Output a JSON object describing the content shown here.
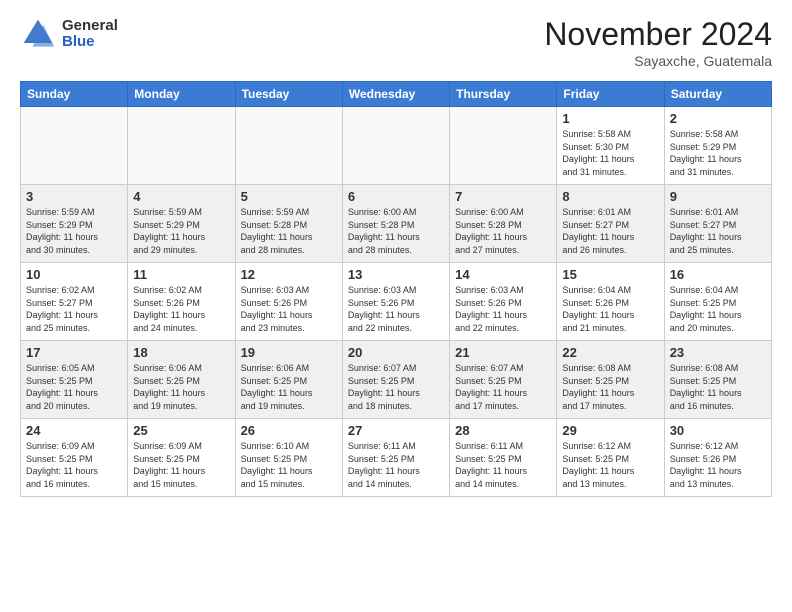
{
  "header": {
    "logo_general": "General",
    "logo_blue": "Blue",
    "month_title": "November 2024",
    "location": "Sayaxche, Guatemala"
  },
  "weekdays": [
    "Sunday",
    "Monday",
    "Tuesday",
    "Wednesday",
    "Thursday",
    "Friday",
    "Saturday"
  ],
  "weeks": [
    [
      {
        "day": "",
        "info": ""
      },
      {
        "day": "",
        "info": ""
      },
      {
        "day": "",
        "info": ""
      },
      {
        "day": "",
        "info": ""
      },
      {
        "day": "",
        "info": ""
      },
      {
        "day": "1",
        "info": "Sunrise: 5:58 AM\nSunset: 5:30 PM\nDaylight: 11 hours\nand 31 minutes."
      },
      {
        "day": "2",
        "info": "Sunrise: 5:58 AM\nSunset: 5:29 PM\nDaylight: 11 hours\nand 31 minutes."
      }
    ],
    [
      {
        "day": "3",
        "info": "Sunrise: 5:59 AM\nSunset: 5:29 PM\nDaylight: 11 hours\nand 30 minutes."
      },
      {
        "day": "4",
        "info": "Sunrise: 5:59 AM\nSunset: 5:29 PM\nDaylight: 11 hours\nand 29 minutes."
      },
      {
        "day": "5",
        "info": "Sunrise: 5:59 AM\nSunset: 5:28 PM\nDaylight: 11 hours\nand 28 minutes."
      },
      {
        "day": "6",
        "info": "Sunrise: 6:00 AM\nSunset: 5:28 PM\nDaylight: 11 hours\nand 28 minutes."
      },
      {
        "day": "7",
        "info": "Sunrise: 6:00 AM\nSunset: 5:28 PM\nDaylight: 11 hours\nand 27 minutes."
      },
      {
        "day": "8",
        "info": "Sunrise: 6:01 AM\nSunset: 5:27 PM\nDaylight: 11 hours\nand 26 minutes."
      },
      {
        "day": "9",
        "info": "Sunrise: 6:01 AM\nSunset: 5:27 PM\nDaylight: 11 hours\nand 25 minutes."
      }
    ],
    [
      {
        "day": "10",
        "info": "Sunrise: 6:02 AM\nSunset: 5:27 PM\nDaylight: 11 hours\nand 25 minutes."
      },
      {
        "day": "11",
        "info": "Sunrise: 6:02 AM\nSunset: 5:26 PM\nDaylight: 11 hours\nand 24 minutes."
      },
      {
        "day": "12",
        "info": "Sunrise: 6:03 AM\nSunset: 5:26 PM\nDaylight: 11 hours\nand 23 minutes."
      },
      {
        "day": "13",
        "info": "Sunrise: 6:03 AM\nSunset: 5:26 PM\nDaylight: 11 hours\nand 22 minutes."
      },
      {
        "day": "14",
        "info": "Sunrise: 6:03 AM\nSunset: 5:26 PM\nDaylight: 11 hours\nand 22 minutes."
      },
      {
        "day": "15",
        "info": "Sunrise: 6:04 AM\nSunset: 5:26 PM\nDaylight: 11 hours\nand 21 minutes."
      },
      {
        "day": "16",
        "info": "Sunrise: 6:04 AM\nSunset: 5:25 PM\nDaylight: 11 hours\nand 20 minutes."
      }
    ],
    [
      {
        "day": "17",
        "info": "Sunrise: 6:05 AM\nSunset: 5:25 PM\nDaylight: 11 hours\nand 20 minutes."
      },
      {
        "day": "18",
        "info": "Sunrise: 6:06 AM\nSunset: 5:25 PM\nDaylight: 11 hours\nand 19 minutes."
      },
      {
        "day": "19",
        "info": "Sunrise: 6:06 AM\nSunset: 5:25 PM\nDaylight: 11 hours\nand 19 minutes."
      },
      {
        "day": "20",
        "info": "Sunrise: 6:07 AM\nSunset: 5:25 PM\nDaylight: 11 hours\nand 18 minutes."
      },
      {
        "day": "21",
        "info": "Sunrise: 6:07 AM\nSunset: 5:25 PM\nDaylight: 11 hours\nand 17 minutes."
      },
      {
        "day": "22",
        "info": "Sunrise: 6:08 AM\nSunset: 5:25 PM\nDaylight: 11 hours\nand 17 minutes."
      },
      {
        "day": "23",
        "info": "Sunrise: 6:08 AM\nSunset: 5:25 PM\nDaylight: 11 hours\nand 16 minutes."
      }
    ],
    [
      {
        "day": "24",
        "info": "Sunrise: 6:09 AM\nSunset: 5:25 PM\nDaylight: 11 hours\nand 16 minutes."
      },
      {
        "day": "25",
        "info": "Sunrise: 6:09 AM\nSunset: 5:25 PM\nDaylight: 11 hours\nand 15 minutes."
      },
      {
        "day": "26",
        "info": "Sunrise: 6:10 AM\nSunset: 5:25 PM\nDaylight: 11 hours\nand 15 minutes."
      },
      {
        "day": "27",
        "info": "Sunrise: 6:11 AM\nSunset: 5:25 PM\nDaylight: 11 hours\nand 14 minutes."
      },
      {
        "day": "28",
        "info": "Sunrise: 6:11 AM\nSunset: 5:25 PM\nDaylight: 11 hours\nand 14 minutes."
      },
      {
        "day": "29",
        "info": "Sunrise: 6:12 AM\nSunset: 5:25 PM\nDaylight: 11 hours\nand 13 minutes."
      },
      {
        "day": "30",
        "info": "Sunrise: 6:12 AM\nSunset: 5:26 PM\nDaylight: 11 hours\nand 13 minutes."
      }
    ]
  ]
}
